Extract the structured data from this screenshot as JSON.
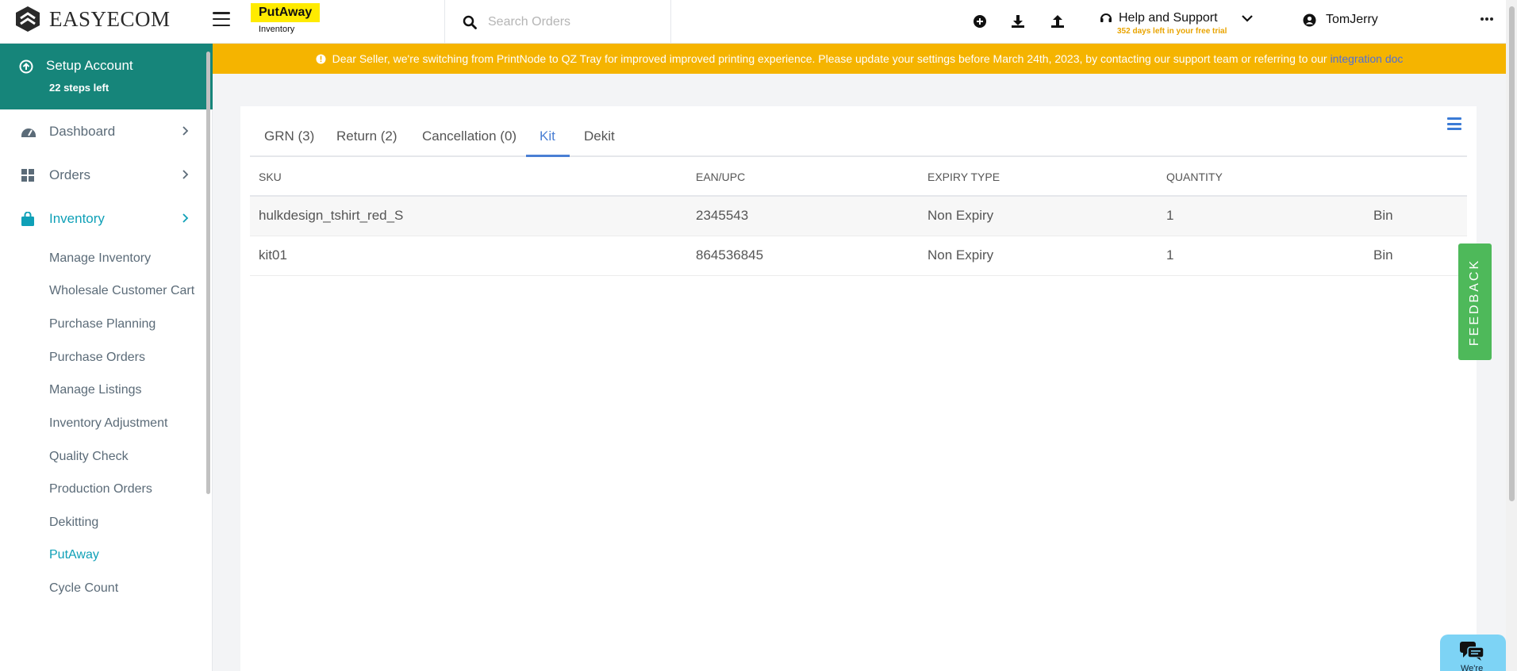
{
  "app": {
    "logo_text": "EASYECOM"
  },
  "page_tag": {
    "title": "PutAway",
    "subtitle": "Inventory"
  },
  "search": {
    "placeholder": "Search Orders"
  },
  "help": {
    "title": "Help and Support",
    "trial": "352 days left in your free trial"
  },
  "user": {
    "name": "TomJerry"
  },
  "banner": {
    "text": "Dear Seller, we're switching from PrintNode to QZ Tray for improved improved printing experience. Please update your settings before March 24th, 2023, by contacting our support team or referring to our",
    "link": "integration doc"
  },
  "setup": {
    "title": "Setup Account",
    "subtitle": "22 steps left"
  },
  "sidebar": {
    "items": [
      {
        "label": "Dashboard"
      },
      {
        "label": "Orders"
      },
      {
        "label": "Inventory"
      }
    ],
    "subitems": [
      {
        "label": "Manage Inventory"
      },
      {
        "label": "Wholesale Customer Cart"
      },
      {
        "label": "Purchase Planning"
      },
      {
        "label": "Purchase Orders"
      },
      {
        "label": "Manage Listings"
      },
      {
        "label": "Inventory Adjustment"
      },
      {
        "label": "Quality Check"
      },
      {
        "label": "Production Orders"
      },
      {
        "label": "Dekitting"
      },
      {
        "label": "PutAway"
      },
      {
        "label": "Cycle Count"
      }
    ]
  },
  "tabs": [
    {
      "label": "GRN (3)"
    },
    {
      "label": "Return (2)"
    },
    {
      "label": "Cancellation (0)"
    },
    {
      "label": "Kit"
    },
    {
      "label": "Dekit"
    }
  ],
  "table": {
    "headers": [
      "SKU",
      "EAN/UPC",
      "EXPIRY TYPE",
      "QUANTITY"
    ],
    "rows": [
      [
        "hulkdesign_tshirt_red_S",
        "2345543",
        "Non Expiry",
        "1",
        "Bin"
      ],
      [
        "kit01",
        "864536845",
        "Non Expiry",
        "1",
        "Bin"
      ]
    ]
  },
  "feedback": {
    "label": "FEEDBACK"
  },
  "chat": {
    "label": "We're"
  },
  "colors": {
    "accent_teal": "#16857a",
    "active_nav": "#0fa0b7",
    "banner": "#f5b400",
    "tab_active": "#4a7fd4",
    "feedback": "#4eb95a"
  }
}
